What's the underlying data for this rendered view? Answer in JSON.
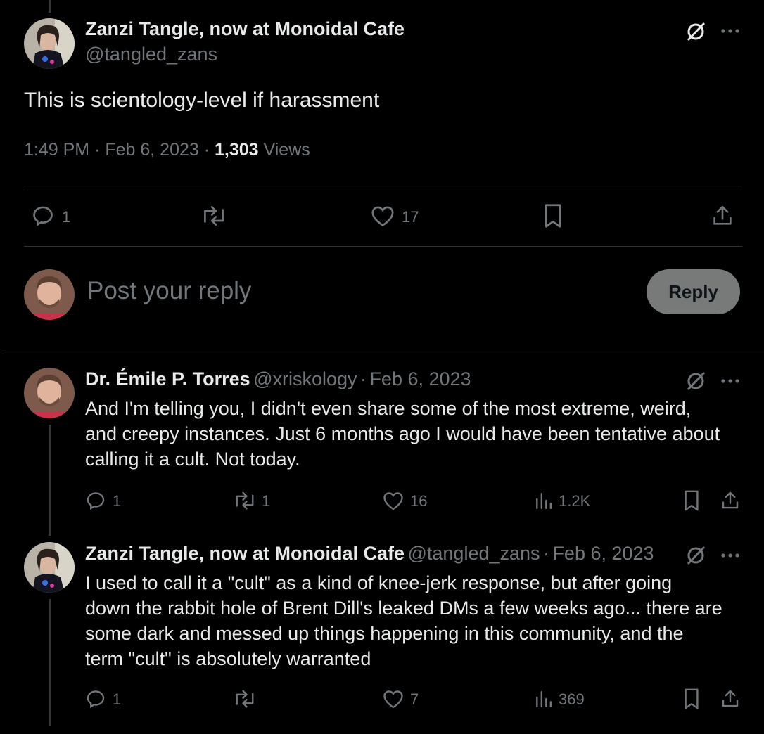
{
  "main_post": {
    "author_name": "Zanzi Tangle, now at Monoidal Cafe",
    "author_handle": "@tangled_zans",
    "text": "This is scientology-level if harassment",
    "time": "1:49 PM",
    "date": "Feb 6, 2023",
    "views_count": "1,303",
    "views_label": "Views",
    "stats": {
      "replies": "1",
      "likes": "17"
    }
  },
  "composer": {
    "placeholder": "Post your reply",
    "reply_button": "Reply"
  },
  "replies": [
    {
      "author_name": "Dr. Émile P. Torres",
      "author_handle": "@xriskology",
      "date": "Feb 6, 2023",
      "lines": [
        "And I'm telling you, I didn't even share some of the most extreme, weird,",
        "and creepy instances. Just 6 months ago I would have been tentative about",
        "calling it a cult. Not today."
      ],
      "stats": {
        "replies": "1",
        "reposts": "1",
        "likes": "16",
        "views": "1.2K"
      }
    },
    {
      "author_name": "Zanzi Tangle, now at Monoidal Cafe",
      "author_handle": "@tangled_zans",
      "date": "Feb 6, 2023",
      "lines": [
        "I used to call it a \"cult\" as a kind of knee-jerk response, but after going",
        "down the rabbit hole of Brent Dill's leaked DMs a few weeks ago... there are",
        "some dark and messed up things happening in this community, and the",
        "term \"cult\" is absolutely warranted"
      ],
      "stats": {
        "replies": "1",
        "likes": "7",
        "views": "369"
      }
    }
  ],
  "separator": "·",
  "colors": {
    "background": "#000000",
    "text": "#e7e9ea",
    "muted": "#71767b",
    "divider": "#2f3336",
    "reply_button_bg": "#787a7a"
  }
}
